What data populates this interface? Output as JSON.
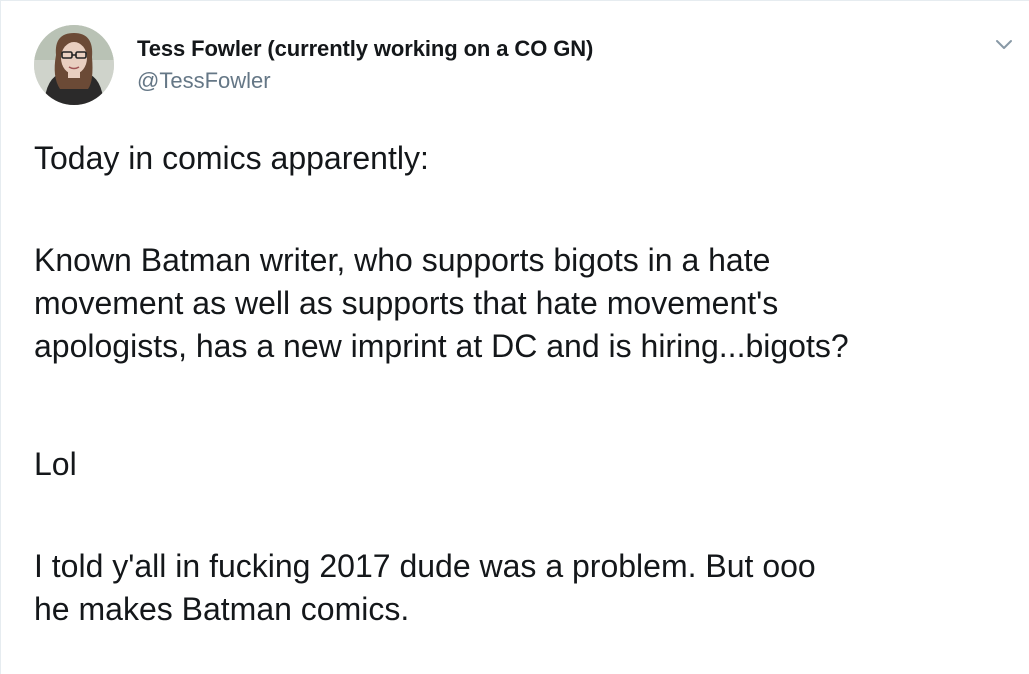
{
  "author": {
    "display_name": "Tess Fowler (currently working on a CO GN)",
    "handle": "@TessFowler",
    "avatar_icon": "profile-photo"
  },
  "menu": {
    "icon": "chevron-down-icon"
  },
  "tweet": {
    "paragraphs": [
      "Today in comics apparently:",
      "Known Batman writer, who supports bigots in a hate\nmovement as well as supports that hate movement's\napologists, has a new imprint at DC and is hiring...bigots?",
      "Lol",
      "I told y'all in fucking 2017 dude was a problem. But ooo\nhe makes Batman comics."
    ]
  },
  "colors": {
    "text_primary": "#14171a",
    "text_secondary": "#657786",
    "border": "#e6ecf0",
    "background": "#ffffff"
  }
}
